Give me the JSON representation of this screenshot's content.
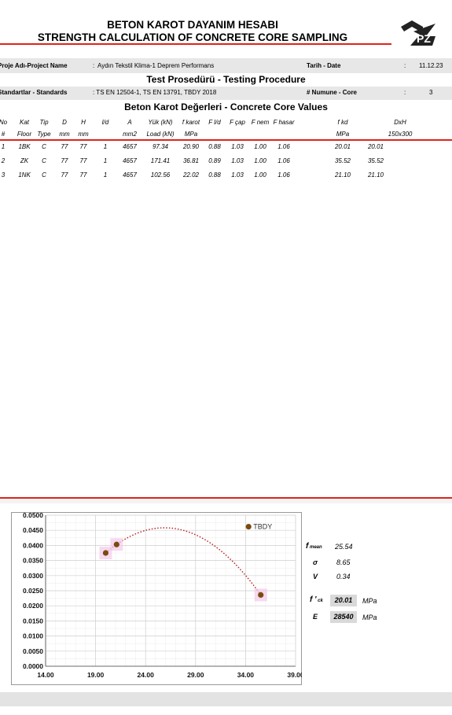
{
  "header": {
    "title_tr": "BETON KAROT DAYANIM HESABI",
    "title_en": "STRENGTH CALCULATION OF CONCRETE CORE SAMPLING",
    "logo_text": "PZ"
  },
  "project": {
    "label": "Proje Adı-Project Name",
    "colon": ":",
    "value": "Aydın Tekstil Klima-1 Deprem Performans",
    "date_label": "Tarih - Date",
    "date_colon": ":",
    "date_value": "11.12.23"
  },
  "procedure_title": "Test Prosedürü - Testing Procedure",
  "standards": {
    "label": "Standartlar - Standards",
    "value": ": TS EN 12504-1, TS EN 13791, TBDY 2018",
    "core_label": "# Numune - Core",
    "core_colon": ":",
    "core_value": "3"
  },
  "values_title": "Beton Karot Değerleri - Concrete Core Values",
  "table": {
    "header1": [
      "No",
      "Kat",
      "Tip",
      "D",
      "H",
      "l/d",
      "A",
      "Yük (kN)",
      "f karot",
      "F l/d",
      "F çap",
      "F nem",
      "F hasar",
      "f kd",
      "DxH"
    ],
    "header2": [
      "#",
      "Floor",
      "Type",
      "mm",
      "mm",
      "",
      "mm2",
      "Load (kN)",
      "MPa",
      "",
      "",
      "",
      "",
      "MPa",
      "150x300"
    ],
    "rows": [
      [
        "1",
        "1BK",
        "C",
        "77",
        "77",
        "1",
        "4657",
        "97.34",
        "20.90",
        "0.88",
        "1.03",
        "1.00",
        "1.06",
        "20.01",
        "20.01"
      ],
      [
        "2",
        "ZK",
        "C",
        "77",
        "77",
        "1",
        "4657",
        "171.41",
        "36.81",
        "0.89",
        "1.03",
        "1.00",
        "1.06",
        "35.52",
        "35.52"
      ],
      [
        "3",
        "1NK",
        "C",
        "77",
        "77",
        "1",
        "4657",
        "102.56",
        "22.02",
        "0.88",
        "1.03",
        "1.00",
        "1.06",
        "21.10",
        "21.10"
      ]
    ]
  },
  "chart_data": {
    "type": "scatter",
    "x_ticks": [
      "14.00",
      "19.00",
      "24.00",
      "29.00",
      "34.00",
      "39.00"
    ],
    "y_ticks": [
      "0.0500",
      "0.0450",
      "0.0400",
      "0.0350",
      "0.0300",
      "0.0250",
      "0.0200",
      "0.0150",
      "0.0100",
      "0.0050",
      "0.0000"
    ],
    "xlim": [
      14,
      39
    ],
    "ylim": [
      0,
      0.05
    ],
    "grid": true,
    "points": [
      {
        "x": 20.01,
        "y": 0.0375
      },
      {
        "x": 21.1,
        "y": 0.0403
      },
      {
        "x": 35.52,
        "y": 0.0236
      }
    ],
    "tbdy_point": {
      "x": 34.3,
      "y": 0.0462,
      "label": "TBDY"
    },
    "trendline": "polynomial",
    "colors": {
      "point": "#7a4a10",
      "trend": "#b71c1c",
      "halo": "#f4c9ea"
    }
  },
  "stats": {
    "fmean_label": "f mean",
    "fmean_value": "25.54",
    "sigma_label": "σ",
    "sigma_value": "8.65",
    "v_label": "V",
    "v_value": "0.34",
    "fck_label": "f ' ck",
    "fck_value": "20.01",
    "fck_unit": "MPa",
    "e_label": "E",
    "e_value": "28540",
    "e_unit": "MPa"
  }
}
